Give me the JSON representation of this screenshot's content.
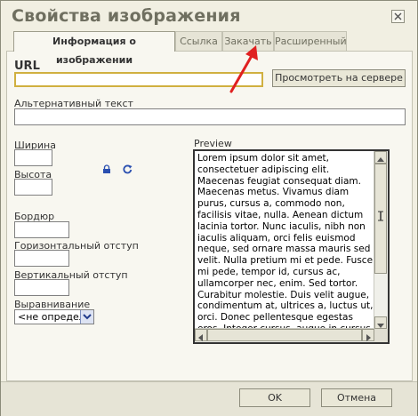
{
  "dialog": {
    "title": "Свойства изображения",
    "tabs": [
      {
        "label": "Информация о изображении",
        "active": true
      },
      {
        "label": "Ссылка",
        "active": false
      },
      {
        "label": "Закачать",
        "active": false
      },
      {
        "label": "Расширенный",
        "active": false
      }
    ]
  },
  "form": {
    "url_label": "URL",
    "url_value": "",
    "browse_label": "Просмотреть на сервере",
    "alt_label": "Альтернативный текст",
    "alt_value": "",
    "width_label": "Ширина",
    "width_value": "",
    "height_label": "Высота",
    "height_value": "",
    "border_label": "Бордюр",
    "border_value": "",
    "hspace_label": "Горизонтальный отступ",
    "hspace_value": "",
    "vspace_label": "Вертикальный отступ",
    "vspace_value": "",
    "align_label": "Выравнивание",
    "align_value": "<не определ"
  },
  "preview": {
    "label": "Preview",
    "text": "Lorem ipsum dolor sit amet, consectetuer adipiscing elit. Maecenas feugiat consequat diam. Maecenas metus. Vivamus diam purus, cursus a, commodo non, facilisis vitae, nulla. Aenean dictum lacinia tortor. Nunc iaculis, nibh non iaculis aliquam, orci felis euismod neque, sed ornare massa mauris sed velit. Nulla pretium mi et pede. Fusce mi pede, tempor id, cursus ac, ullamcorper nec, enim. Sed tortor. Curabitur molestie. Duis velit augue, condimentum at, ultrices a, luctus ut, orci. Donec pellentesque egestas eros. Integer cursus, augue in cursus faucibus, eros pede bibendum sem, in tempus tellus justo quis ligula. Etiam eget tortor. Vestibulum"
  },
  "footer": {
    "ok_label": "OK",
    "cancel_label": "Отмена"
  },
  "colors": {
    "annotation_arrow": "#e02020",
    "url_field_border": "#d0b040",
    "tab_active_bg": "#f8f7f0",
    "dialog_bg": "#f1efe2"
  }
}
